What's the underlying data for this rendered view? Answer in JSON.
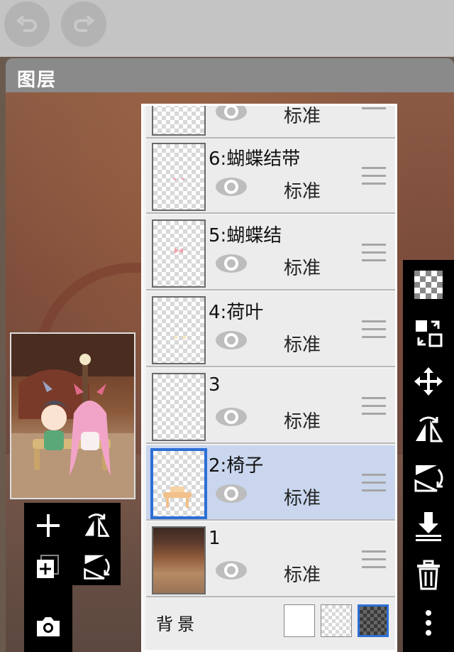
{
  "topbar": {
    "undo_icon": "undo-icon",
    "redo_icon": "redo-icon"
  },
  "panel": {
    "title": "图层"
  },
  "layers": [
    {
      "name": "",
      "blend": "标准",
      "selected": false
    },
    {
      "name": "6:蝴蝶结带",
      "blend": "标准",
      "selected": false
    },
    {
      "name": "5:蝴蝶结",
      "blend": "标准",
      "selected": false
    },
    {
      "name": "4:荷叶",
      "blend": "标准",
      "selected": false
    },
    {
      "name": "3",
      "blend": "标准",
      "selected": false
    },
    {
      "name": "2:椅子",
      "blend": "标准",
      "selected": true
    },
    {
      "name": "1",
      "blend": "标准",
      "selected": false
    }
  ],
  "background": {
    "label": "背景",
    "options": [
      "white",
      "transparent",
      "dark-checker"
    ],
    "selected": "dark-checker"
  },
  "right_toolbar": [
    "transparency-icon",
    "swap-layer-icon",
    "move-icon",
    "flip-horizontal-icon",
    "flip-vertical-icon",
    "merge-down-icon",
    "delete-icon",
    "more-icon"
  ],
  "left_toolbar": [
    "add-layer-icon",
    "flip-horizontal-icon",
    "duplicate-layer-icon",
    "flip-vertical-icon",
    "camera-icon"
  ],
  "colors": {
    "selected_row": "#c9d6ee",
    "selected_border": "#2c6fd6"
  }
}
